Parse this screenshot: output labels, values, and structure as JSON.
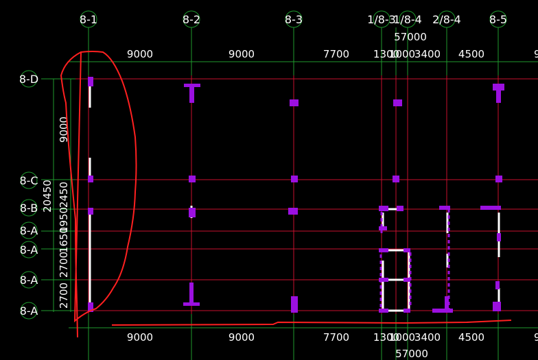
{
  "colors": {
    "background": "#000000",
    "grid_line": "#c8102e",
    "dimension_line": "#1f9a2e",
    "column": "#9b10e0",
    "wall": "#ffffff",
    "markup": "#ff2020",
    "text": "#ffffff"
  },
  "axes_top": [
    {
      "id": "ax-8-1",
      "label": "8-1"
    },
    {
      "id": "ax-8-2",
      "label": "8-2"
    },
    {
      "id": "ax-8-3",
      "label": "8-3"
    },
    {
      "id": "ax-1-8-3",
      "label": "1/8-3"
    },
    {
      "id": "ax-1-8-4",
      "label": "1/8-4"
    },
    {
      "id": "ax-2-8-4",
      "label": "2/8-4"
    },
    {
      "id": "ax-8-5",
      "label": "8-5"
    }
  ],
  "axes_left": [
    {
      "id": "ax-8-d",
      "label": "8-D"
    },
    {
      "id": "ax-8-c",
      "label": "8-C"
    },
    {
      "id": "ax-8-b",
      "label": "8-B"
    },
    {
      "id": "ax-8-a-1",
      "label": "8-A"
    },
    {
      "id": "ax-8-a-2",
      "label": "8-A"
    },
    {
      "id": "ax-8-a-3",
      "label": "8-A"
    },
    {
      "id": "ax-8-a-4",
      "label": "8-A"
    }
  ],
  "dims_top": {
    "total": "57000",
    "segments": [
      "9000",
      "9000",
      "7700",
      "1300",
      "1000",
      "3400",
      "4500",
      "9"
    ]
  },
  "dims_bottom": {
    "total": "57000",
    "segments": [
      "9000",
      "9000",
      "7700",
      "1300",
      "1000",
      "3400",
      "4500",
      "9"
    ]
  },
  "dims_left": {
    "total": "20450",
    "upper": "9000",
    "segments": [
      "2450",
      "1950",
      "1650",
      "2700",
      "2700"
    ]
  }
}
